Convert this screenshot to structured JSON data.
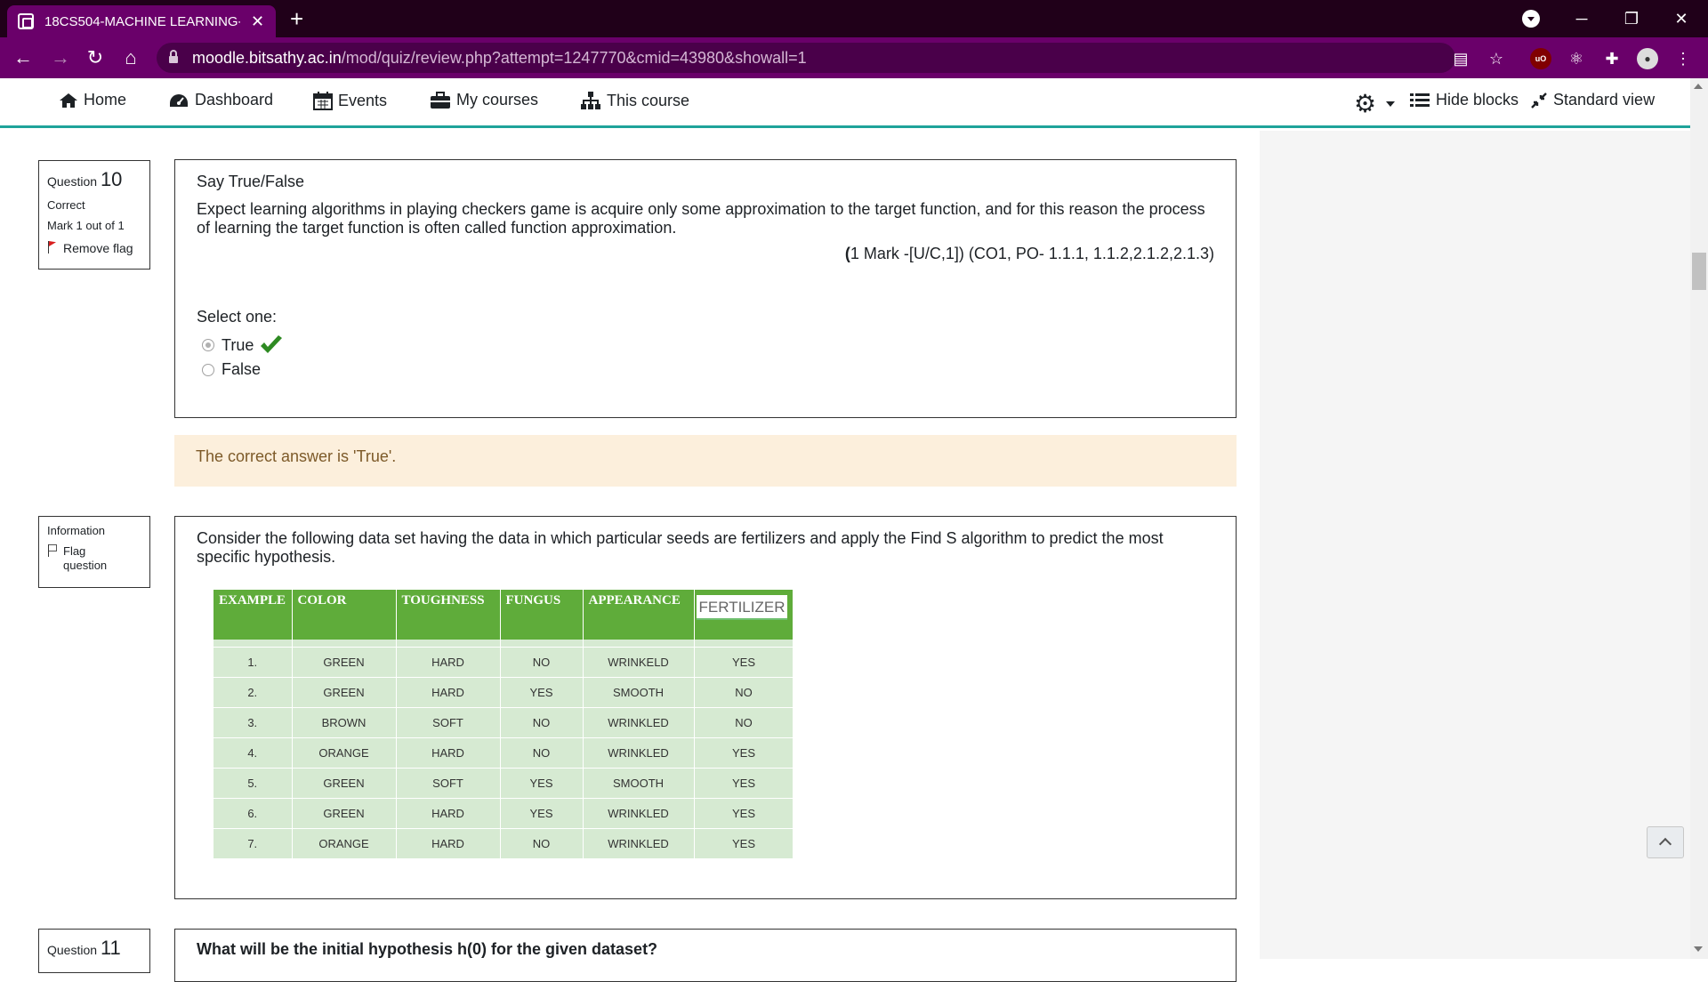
{
  "browser": {
    "tab_title": "18CS504-MACHINE LEARNING-2",
    "tab_close": "✕",
    "new_tab": "+",
    "url_host": "moodle.bitsathy.ac.in",
    "url_path": "/mod/quiz/review.php?attempt=1247770&cmid=43980&showall=1",
    "ublock_label": "uO"
  },
  "navbar": {
    "home": "Home",
    "dashboard": "Dashboard",
    "events": "Events",
    "my_courses": "My courses",
    "this_course": "This course",
    "hide_blocks": "Hide blocks",
    "standard_view": "Standard view"
  },
  "question10": {
    "label": "Question",
    "number": "10",
    "state": "Correct",
    "mark": "Mark 1 out of 1",
    "flag_label": "Remove flag",
    "title": "Say True/False",
    "text": "Expect learning algorithms in playing checkers game is acquire only some approximation to the target function, and for this reason the process of learning the target function is often called function approximation.",
    "ref_open": "(",
    "ref": "1 Mark -[U/C,1]) (CO1, PO- 1.1.1, 1.1.2,2.1.2,2.1.3)",
    "select_one": "Select one:",
    "options": [
      "True",
      "False"
    ],
    "selected": "True",
    "feedback": "The correct answer is 'True'."
  },
  "information": {
    "label": "Information",
    "flag_label": "Flag question",
    "text": "Consider the following data set having the data in which particular seeds are fertilizers and apply the Find S algorithm to predict the most specific hypothesis.",
    "table": {
      "headers": [
        "EXAMPLE",
        "COLOR",
        "TOUGHNESS",
        "FUNGUS",
        "APPEARANCE",
        "FERTILIZER"
      ],
      "rows": [
        [
          "1.",
          "GREEN",
          "HARD",
          "NO",
          "WRINKELD",
          "YES"
        ],
        [
          "2.",
          "GREEN",
          "HARD",
          "YES",
          "SMOOTH",
          "NO"
        ],
        [
          "3.",
          "BROWN",
          "SOFT",
          "NO",
          "WRINKLED",
          "NO"
        ],
        [
          "4.",
          "ORANGE",
          "HARD",
          "NO",
          "WRINKLED",
          "YES"
        ],
        [
          "5.",
          "GREEN",
          "SOFT",
          "YES",
          "SMOOTH",
          "YES"
        ],
        [
          "6.",
          "GREEN",
          "HARD",
          "YES",
          "WRINKLED",
          "YES"
        ],
        [
          "7.",
          "ORANGE",
          "HARD",
          "NO",
          "WRINKLED",
          "YES"
        ]
      ]
    }
  },
  "question11": {
    "label": "Question",
    "number": "11",
    "text": "What will be the initial hypothesis h(0) for the given dataset?"
  }
}
